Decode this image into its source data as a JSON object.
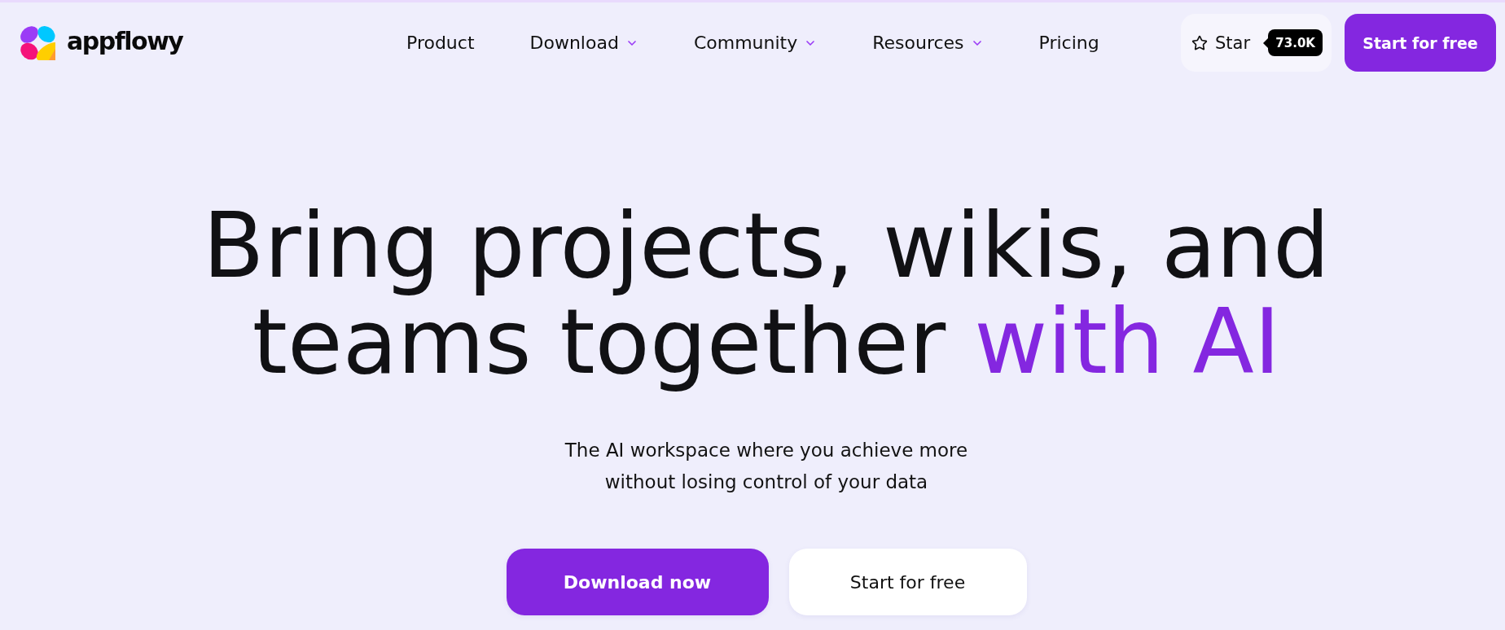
{
  "header": {
    "logo": {
      "wordmark": "appflowy"
    },
    "nav": [
      {
        "label": "Product",
        "has_menu": false
      },
      {
        "label": "Download",
        "has_menu": true
      },
      {
        "label": "Community",
        "has_menu": true
      },
      {
        "label": "Resources",
        "has_menu": true
      },
      {
        "label": "Pricing",
        "has_menu": false
      }
    ],
    "star_button": {
      "label": "Star",
      "count": "73.0K"
    },
    "cta_button": {
      "label": "Start for free"
    }
  },
  "hero": {
    "headline": [
      [
        {
          "text": "Bring projects, wikis, and",
          "accent": false
        }
      ],
      [
        {
          "text": "teams together",
          "accent": false
        },
        {
          "text": "with AI",
          "accent": true
        }
      ]
    ],
    "subtitle": [
      "The AI workspace where you achieve more",
      "without losing control of your data"
    ],
    "buttons": [
      {
        "label": "Download now",
        "kind": "primary"
      },
      {
        "label": "Start for free",
        "kind": "secondary"
      }
    ]
  }
}
